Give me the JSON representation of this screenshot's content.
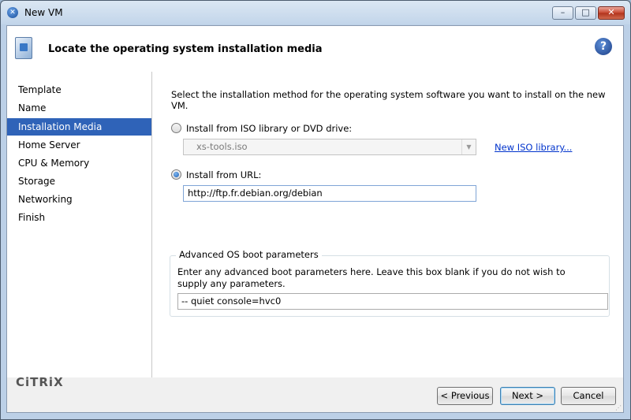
{
  "window": {
    "title": "New VM",
    "minimize_glyph": "–",
    "maximize_glyph": "□",
    "close_glyph": "✕"
  },
  "header": {
    "title": "Locate the operating system installation media",
    "help_glyph": "?"
  },
  "sidebar": {
    "items": [
      {
        "label": "Template"
      },
      {
        "label": "Name"
      },
      {
        "label": "Installation Media"
      },
      {
        "label": "Home Server"
      },
      {
        "label": "CPU & Memory"
      },
      {
        "label": "Storage"
      },
      {
        "label": "Networking"
      },
      {
        "label": "Finish"
      }
    ],
    "active_index": 2,
    "logo_text": "CiTRiX"
  },
  "main": {
    "intro": "Select the installation method for the operating system software you want to install on the new VM.",
    "iso_option": {
      "label": "Install from ISO library or DVD drive:",
      "checked": false
    },
    "iso_select": {
      "value": "xs-tools.iso",
      "enabled": false
    },
    "iso_link": "New ISO library...",
    "url_option": {
      "label": "Install from URL:",
      "checked": true
    },
    "url_input": {
      "value": "http://ftp.fr.debian.org/debian"
    },
    "advanced": {
      "legend": "Advanced OS boot parameters",
      "description": "Enter any advanced boot parameters here. Leave this box blank if you do not wish to supply any parameters.",
      "value": "-- quiet console=hvc0"
    }
  },
  "footer": {
    "previous": "< Previous",
    "next": "Next >",
    "cancel": "Cancel"
  },
  "colors": {
    "selection": "#2f63b8",
    "link": "#0033cc",
    "title_close": "#c8462e"
  }
}
